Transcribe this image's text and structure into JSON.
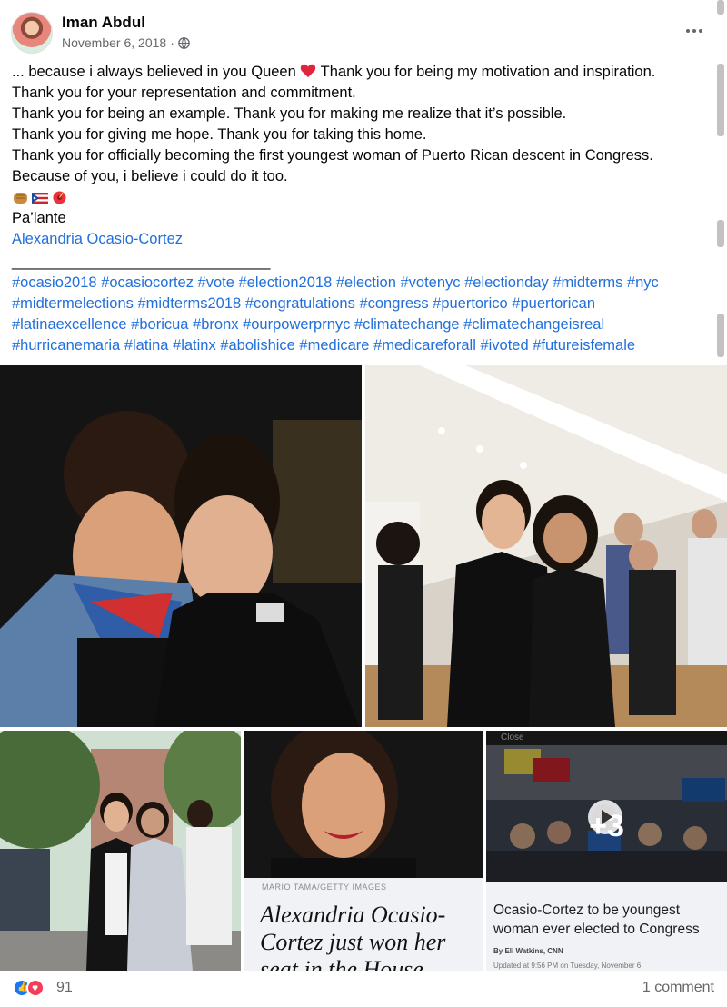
{
  "post": {
    "author": "Iman Abdul",
    "date": "November 6, 2018",
    "dot": "·",
    "privacy_icon": "globe-icon",
    "more_icon": "more-options-icon"
  },
  "body": {
    "line1_pre": "... because i always believed in you Queen",
    "line1_post": " Thank you for being my motivation and inspiration.",
    "line2": "Thank you for your representation and commitment.",
    "line3": "Thank you for being an example. Thank you for making me realize that it’s possible.",
    "line4": "Thank you for giving me hope. Thank you for taking this home.",
    "line5": "Thank you for officially becoming the first youngest woman of Puerto Rican descent in Congress.",
    "line6": "Because of you, i believe i could do it too.",
    "emojis": [
      "fist-emoji",
      "puerto-rico-flag-emoji",
      "hibiscus-flower-emoji"
    ],
    "line8": "Pa’lante",
    "mention": "Alexandria Ocasio-Cortez",
    "divider": "_______________________________",
    "hashtag_lines": [
      "#ocasio2018 #ocasiocortez #vote #election2018 #election #votenyc #electionday #midterms #nyc",
      "#midtermelections #midterms2018 #congratulations #congress #puertorico #puertorican",
      "#latinaexcellence #boricua #bronx #ourpowerprnyc #climatechange #climatechangeisreal",
      "#hurricanemaria #latina #latinx #abolishice #medicare #medicareforall #ivoted #futureisfemale"
    ]
  },
  "photos": {
    "article1": {
      "credit": "MARIO TAMA/GETTY IMAGES",
      "title_l1": "Alexandria Ocasio-",
      "title_l2": "Cortez just won her",
      "title_l3": "seat in the House"
    },
    "article2": {
      "close": "Close",
      "title_l1": "Ocasio-Cortez to be youngest",
      "title_l2": "woman ever elected to Congress",
      "byline": "By Eli Watkins, CNN",
      "updated": "Updated at 9:56 PM on Tuesday, November 6",
      "more_count": "+3"
    }
  },
  "footer": {
    "reaction_count": "91",
    "comments": "1 comment"
  },
  "colors": {
    "link": "#216fdb",
    "muted": "#65676b",
    "like": "#1877f2",
    "love": "#f33e58"
  }
}
